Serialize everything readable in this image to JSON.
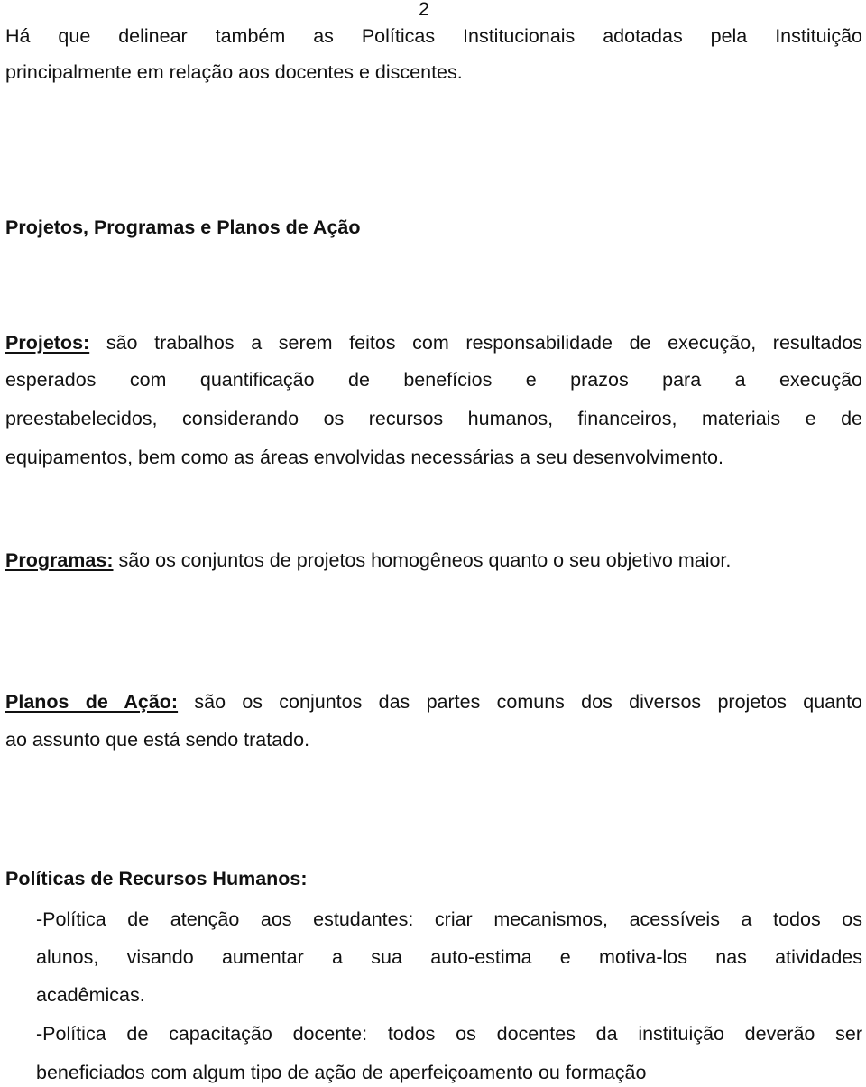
{
  "page_number": "2",
  "intro": {
    "line1": "Há que delinear também as Políticas Institucionais adotadas pela Instituição",
    "line2": "principalmente em relação aos docentes e discentes."
  },
  "section_heading": "Projetos, Programas e Planos de Ação",
  "projetos": {
    "term": "Projetos:",
    "line1": " são trabalhos a serem feitos com responsabilidade de execução, resultados",
    "line2": "esperados com quantificação de benefícios e prazos para a execução",
    "line3": "preestabelecidos, considerando os recursos humanos, financeiros, materiais e de",
    "line4": "equipamentos, bem como as áreas envolvidas necessárias a seu desenvolvimento."
  },
  "programas": {
    "term": "Programas:",
    "line1": " são os conjuntos de projetos homogêneos quanto o seu objetivo maior."
  },
  "planos": {
    "term": "Planos de Ação:",
    "line1": " são os conjuntos das partes comuns dos diversos projetos quanto",
    "line2": "ao assunto que está sendo tratado."
  },
  "politicas": {
    "heading": "Políticas de Recursos Humanos:",
    "items": [
      {
        "lines": [
          "-Política de atenção aos estudantes: criar mecanismos, acessíveis a todos os",
          "alunos, visando aumentar a sua auto-estima e motiva-los nas atividades",
          "acadêmicas."
        ]
      },
      {
        "lines": [
          "-Política de capacitação docente: todos os docentes da instituição deverão ser",
          "beneficiados com algum tipo de ação de aperfeiçoamento ou formação"
        ]
      }
    ]
  }
}
